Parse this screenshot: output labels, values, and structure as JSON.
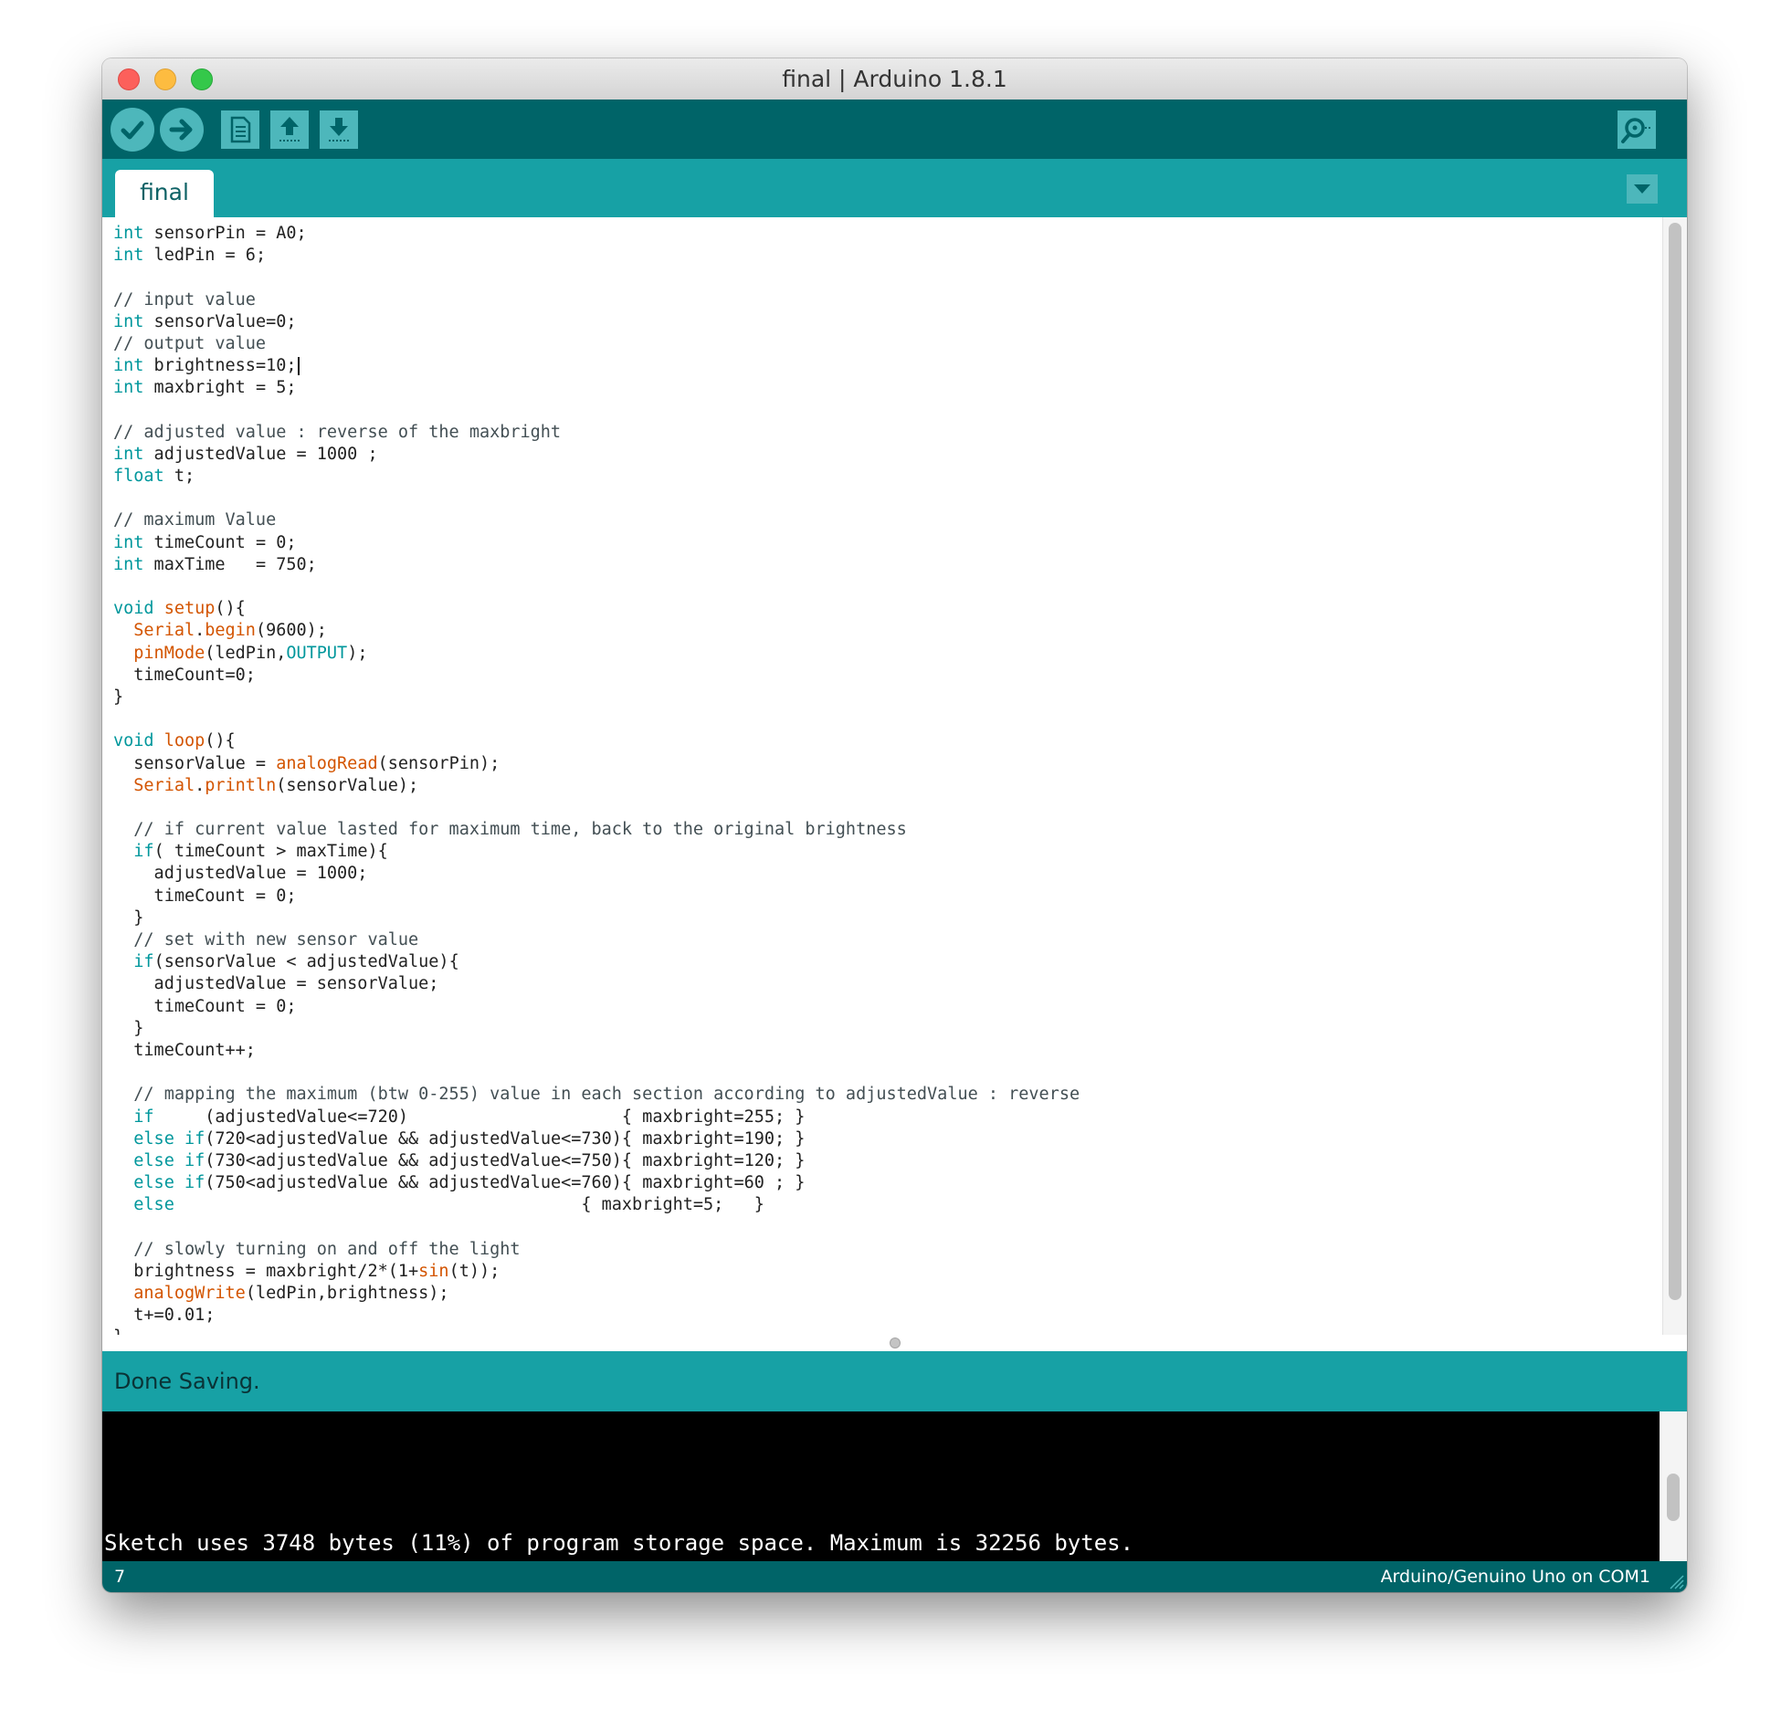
{
  "window": {
    "title": "final | Arduino 1.8.1"
  },
  "toolbar": {
    "buttons": [
      {
        "name": "verify",
        "icon": "checkmark-icon"
      },
      {
        "name": "upload",
        "icon": "arrow-right-icon"
      },
      {
        "name": "new",
        "icon": "document-icon"
      },
      {
        "name": "open",
        "icon": "arrow-up-icon"
      },
      {
        "name": "save",
        "icon": "arrow-down-icon"
      },
      {
        "name": "serial-monitor",
        "icon": "magnifier-icon"
      }
    ],
    "accent": "#4db7bb",
    "background": "#006468"
  },
  "tabs": [
    {
      "label": "final",
      "active": true
    }
  ],
  "editor": {
    "lines": [
      [
        [
          "int",
          "k"
        ],
        [
          " sensorPin = A0;",
          ""
        ]
      ],
      [
        [
          "int",
          "k"
        ],
        [
          " ledPin = 6;",
          ""
        ]
      ],
      [],
      [
        [
          "// input value",
          "c"
        ]
      ],
      [
        [
          "int",
          "k"
        ],
        [
          " sensorValue=0;",
          ""
        ]
      ],
      [
        [
          "// output value",
          "c"
        ]
      ],
      [
        [
          "int",
          "k"
        ],
        [
          " brightness=10;",
          ""
        ],
        [
          "|",
          "caret"
        ]
      ],
      [
        [
          "int",
          "k"
        ],
        [
          " maxbright = 5;",
          ""
        ]
      ],
      [],
      [
        [
          "// adjusted value : reverse of the maxbright",
          "c"
        ]
      ],
      [
        [
          "int",
          "k"
        ],
        [
          " adjustedValue = 1000 ;",
          ""
        ]
      ],
      [
        [
          "float",
          "k"
        ],
        [
          " t;",
          ""
        ]
      ],
      [],
      [
        [
          "// maximum Value",
          "c"
        ]
      ],
      [
        [
          "int",
          "k"
        ],
        [
          " timeCount = 0;",
          ""
        ]
      ],
      [
        [
          "int",
          "k"
        ],
        [
          " maxTime   = 750;",
          ""
        ]
      ],
      [],
      [
        [
          "void",
          "k"
        ],
        [
          " ",
          ""
        ],
        [
          "setup",
          "f"
        ],
        [
          "(){",
          ""
        ]
      ],
      [
        [
          "  ",
          ""
        ],
        [
          "Serial",
          "f"
        ],
        [
          ".",
          ""
        ],
        [
          "begin",
          "f"
        ],
        [
          "(9600);",
          ""
        ]
      ],
      [
        [
          "  ",
          ""
        ],
        [
          "pinMode",
          "f"
        ],
        [
          "(ledPin,",
          ""
        ],
        [
          "OUTPUT",
          "k"
        ],
        [
          ");",
          ""
        ]
      ],
      [
        [
          "  timeCount=0;",
          ""
        ]
      ],
      [
        [
          "}",
          ""
        ]
      ],
      [],
      [
        [
          "void",
          "k"
        ],
        [
          " ",
          ""
        ],
        [
          "loop",
          "f"
        ],
        [
          "(){",
          ""
        ]
      ],
      [
        [
          "  sensorValue = ",
          ""
        ],
        [
          "analogRead",
          "f"
        ],
        [
          "(sensorPin);",
          ""
        ]
      ],
      [
        [
          "  ",
          ""
        ],
        [
          "Serial",
          "f"
        ],
        [
          ".",
          ""
        ],
        [
          "println",
          "f"
        ],
        [
          "(sensorValue);",
          ""
        ]
      ],
      [],
      [
        [
          "  ",
          ""
        ],
        [
          "// if current value lasted for maximum time, back to the original brightness",
          "c"
        ]
      ],
      [
        [
          "  ",
          ""
        ],
        [
          "if",
          "k"
        ],
        [
          "( timeCount > maxTime){",
          ""
        ]
      ],
      [
        [
          "    adjustedValue = 1000;",
          ""
        ]
      ],
      [
        [
          "    timeCount = 0;",
          ""
        ]
      ],
      [
        [
          "  }",
          ""
        ]
      ],
      [
        [
          "  ",
          ""
        ],
        [
          "// set with new sensor value",
          "c"
        ]
      ],
      [
        [
          "  ",
          ""
        ],
        [
          "if",
          "k"
        ],
        [
          "(sensorValue < adjustedValue){",
          ""
        ]
      ],
      [
        [
          "    adjustedValue = sensorValue;",
          ""
        ]
      ],
      [
        [
          "    timeCount = 0;",
          ""
        ]
      ],
      [
        [
          "  }",
          ""
        ]
      ],
      [
        [
          "  timeCount++;",
          ""
        ]
      ],
      [],
      [
        [
          "  ",
          ""
        ],
        [
          "// mapping the maximum (btw 0-255) value in each section according to adjustedValue : reverse",
          "c"
        ]
      ],
      [
        [
          "  ",
          ""
        ],
        [
          "if",
          "k"
        ],
        [
          "     (adjustedValue<=720)                     { maxbright=255; }",
          ""
        ]
      ],
      [
        [
          "  ",
          ""
        ],
        [
          "else",
          "k"
        ],
        [
          " ",
          ""
        ],
        [
          "if",
          "k"
        ],
        [
          "(720<adjustedValue && adjustedValue<=730){ maxbright=190; }",
          ""
        ]
      ],
      [
        [
          "  ",
          ""
        ],
        [
          "else",
          "k"
        ],
        [
          " ",
          ""
        ],
        [
          "if",
          "k"
        ],
        [
          "(730<adjustedValue && adjustedValue<=750){ maxbright=120; }",
          ""
        ]
      ],
      [
        [
          "  ",
          ""
        ],
        [
          "else",
          "k"
        ],
        [
          " ",
          ""
        ],
        [
          "if",
          "k"
        ],
        [
          "(750<adjustedValue && adjustedValue<=760){ maxbright=60 ; }",
          ""
        ]
      ],
      [
        [
          "  ",
          ""
        ],
        [
          "else",
          "k"
        ],
        [
          "                                        { maxbright=5;   }",
          ""
        ]
      ],
      [],
      [
        [
          "  ",
          ""
        ],
        [
          "// slowly turning on and off the light",
          "c"
        ]
      ],
      [
        [
          "  brightness = maxbright/2*(1+",
          ""
        ],
        [
          "sin",
          "f"
        ],
        [
          "(t));",
          ""
        ]
      ],
      [
        [
          "  ",
          ""
        ],
        [
          "analogWrite",
          "f"
        ],
        [
          "(ledPin,brightness);",
          ""
        ]
      ],
      [
        [
          "  t+=0.01;",
          ""
        ]
      ],
      [
        [
          "}",
          ""
        ]
      ]
    ],
    "keyword_color": "#00979c",
    "function_color": "#d35400",
    "comment_color": "#434f54"
  },
  "status": {
    "message": "Done Saving."
  },
  "console": {
    "output": "Sketch uses 3748 bytes (11%) of program storage space. Maximum is 32256 bytes."
  },
  "footer": {
    "line_number": "7",
    "board": "Arduino/Genuino Uno on COM1"
  }
}
